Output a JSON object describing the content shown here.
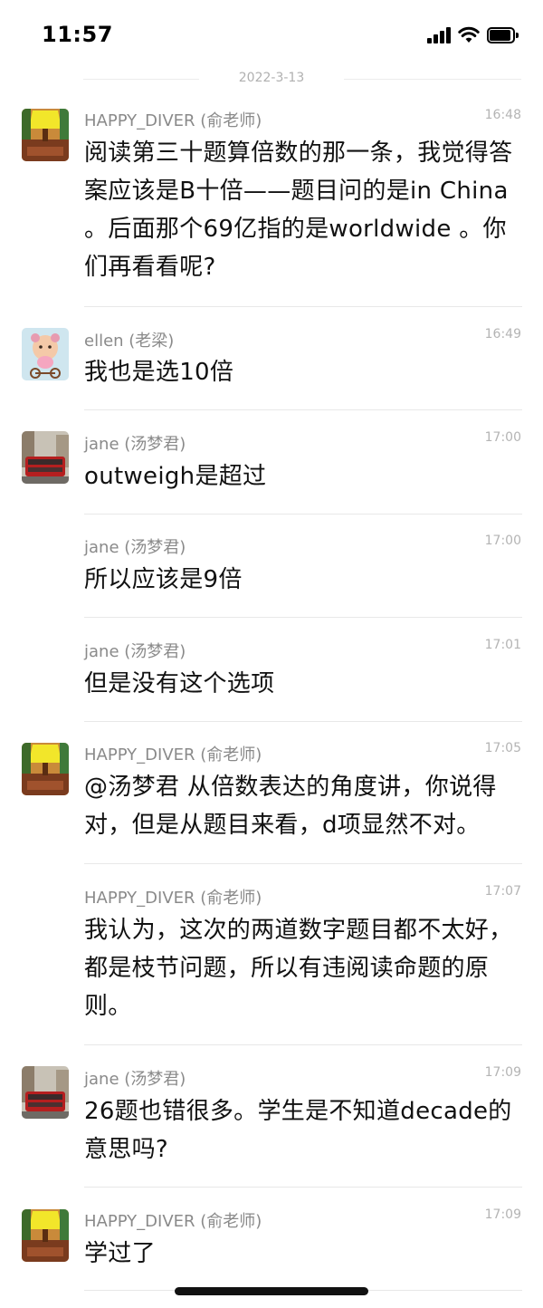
{
  "status": {
    "time": "11:57"
  },
  "date_separator": "2022-3-13",
  "messages": [
    {
      "sender": "HAPPY_DIVER (俞老师)",
      "time": "16:48",
      "avatar": "avatar-lamp",
      "text": "阅读第三十题算倍数的那一条，我觉得答案应该是B十倍——题目问的是in China 。后面那个69亿指的是worldwide 。你们再看看呢?"
    },
    {
      "sender": "ellen (老梁)",
      "time": "16:49",
      "avatar": "avatar-cartoon",
      "text": "我也是选10倍"
    },
    {
      "sender": "jane (汤梦君)",
      "time": "17:00",
      "avatar": "avatar-bus",
      "text": "outweigh是超过"
    },
    {
      "sender": "jane (汤梦君)",
      "time": "17:00",
      "avatar": "",
      "text": "所以应该是9倍"
    },
    {
      "sender": "jane (汤梦君)",
      "time": "17:01",
      "avatar": "",
      "text": "但是没有这个选项"
    },
    {
      "sender": "HAPPY_DIVER (俞老师)",
      "time": "17:05",
      "avatar": "avatar-lamp",
      "text": "@汤梦君 从倍数表达的角度讲，你说得对，但是从题目来看，d项显然不对。"
    },
    {
      "sender": "HAPPY_DIVER (俞老师)",
      "time": "17:07",
      "avatar": "",
      "text": "我认为，这次的两道数字题目都不太好，都是枝节问题，所以有违阅读命题的原则。"
    },
    {
      "sender": "jane (汤梦君)",
      "time": "17:09",
      "avatar": "avatar-bus",
      "text": "26题也错很多。学生是不知道decade的意思吗?"
    },
    {
      "sender": "HAPPY_DIVER (俞老师)",
      "time": "17:09",
      "avatar": "avatar-lamp",
      "text": "学过了"
    }
  ]
}
